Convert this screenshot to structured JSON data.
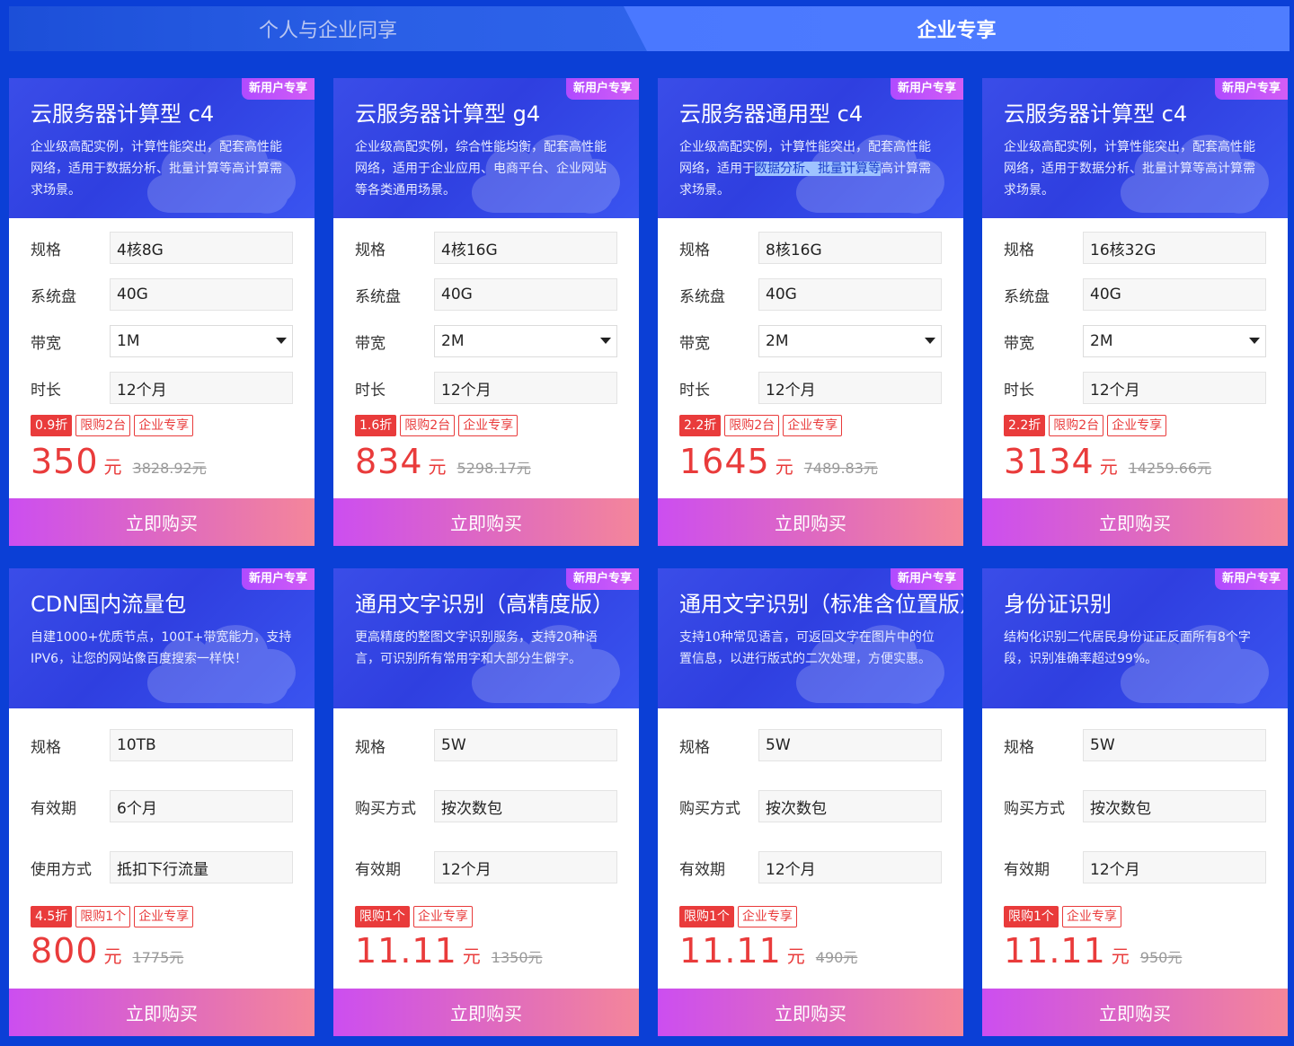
{
  "tabs": [
    {
      "label": "个人与企业同享",
      "active": false
    },
    {
      "label": "企业专享",
      "active": true
    }
  ],
  "colors": {
    "background": "#0b3fd6",
    "price": "#e93b3b",
    "badge": "#c557f8"
  },
  "row1": [
    {
      "badge": "新用户专享",
      "title": "云服务器计算型 c4",
      "desc": "企业级高配实例，计算性能突出，配套高性能网络，适用于数据分析、批量计算等高计算需求场景。",
      "fields": [
        {
          "label": "规格",
          "value": "4核8G",
          "select": false
        },
        {
          "label": "系统盘",
          "value": "40G",
          "select": false
        },
        {
          "label": "带宽",
          "value": "1M",
          "select": true
        },
        {
          "label": "时长",
          "value": "12个月",
          "select": false
        }
      ],
      "tags": [
        "0.9折",
        "限购2台",
        "企业专享"
      ],
      "price": "350",
      "unit": "元",
      "original": "3828.92元",
      "buy": "立即购买"
    },
    {
      "badge": "新用户专享",
      "title": "云服务器计算型 g4",
      "desc": "企业级高配实例，综合性能均衡，配套高性能网络，适用于企业应用、电商平台、企业网站等各类通用场景。",
      "fields": [
        {
          "label": "规格",
          "value": "4核16G",
          "select": false
        },
        {
          "label": "系统盘",
          "value": "40G",
          "select": false
        },
        {
          "label": "带宽",
          "value": "2M",
          "select": true
        },
        {
          "label": "时长",
          "value": "12个月",
          "select": false
        }
      ],
      "tags": [
        "1.6折",
        "限购2台",
        "企业专享"
      ],
      "price": "834",
      "unit": "元",
      "original": "5298.17元",
      "buy": "立即购买"
    },
    {
      "badge": "新用户专享",
      "title": "云服务器通用型 c4",
      "desc_pre": "企业级高配实例，计算性能突出，配套高性能网络，适用于",
      "desc_hl": "数据分析、批量计算等",
      "desc_post": "高计算需求场景。",
      "fields": [
        {
          "label": "规格",
          "value": "8核16G",
          "select": false
        },
        {
          "label": "系统盘",
          "value": "40G",
          "select": false
        },
        {
          "label": "带宽",
          "value": "2M",
          "select": true
        },
        {
          "label": "时长",
          "value": "12个月",
          "select": false
        }
      ],
      "tags": [
        "2.2折",
        "限购2台",
        "企业专享"
      ],
      "price": "1645",
      "unit": "元",
      "original": "7489.83元",
      "buy": "立即购买"
    },
    {
      "badge": "新用户专享",
      "title": "云服务器计算型 c4",
      "desc": "企业级高配实例，计算性能突出，配套高性能网络，适用于数据分析、批量计算等高计算需求场景。",
      "fields": [
        {
          "label": "规格",
          "value": "16核32G",
          "select": false
        },
        {
          "label": "系统盘",
          "value": "40G",
          "select": false
        },
        {
          "label": "带宽",
          "value": "2M",
          "select": true
        },
        {
          "label": "时长",
          "value": "12个月",
          "select": false
        }
      ],
      "tags": [
        "2.2折",
        "限购2台",
        "企业专享"
      ],
      "price": "3134",
      "unit": "元",
      "original": "14259.66元",
      "buy": "立即购买"
    }
  ],
  "row2": [
    {
      "badge": "新用户专享",
      "title": "CDN国内流量包",
      "desc": "自建1000+优质节点，100T+带宽能力，支持IPV6，让您的网站像百度搜索一样快！",
      "fields": [
        {
          "label": "规格",
          "value": "10TB"
        },
        {
          "label": "有效期",
          "value": "6个月"
        },
        {
          "label": "使用方式",
          "value": "抵扣下行流量"
        }
      ],
      "tags": [
        "4.5折",
        "限购1个",
        "企业专享"
      ],
      "price": "800",
      "unit": "元",
      "original": "1775元",
      "buy": "立即购买"
    },
    {
      "badge": "新用户专享",
      "title": "通用文字识别（高精度版）",
      "desc": "更高精度的整图文字识别服务，支持20种语言，可识别所有常用字和大部分生僻字。",
      "fields": [
        {
          "label": "规格",
          "value": "5W"
        },
        {
          "label": "购买方式",
          "value": "按次数包"
        },
        {
          "label": "有效期",
          "value": "12个月"
        }
      ],
      "tags": [
        "限购1个",
        "企业专享"
      ],
      "price": "11.11",
      "unit": "元",
      "original": "1350元",
      "buy": "立即购买"
    },
    {
      "badge": "新用户专享",
      "title": "通用文字识别（标准含位置版）",
      "desc": "支持10种常见语言，可返回文字在图片中的位置信息，以进行版式的二次处理，方便实惠。",
      "fields": [
        {
          "label": "规格",
          "value": "5W"
        },
        {
          "label": "购买方式",
          "value": "按次数包"
        },
        {
          "label": "有效期",
          "value": "12个月"
        }
      ],
      "tags": [
        "限购1个",
        "企业专享"
      ],
      "price": "11.11",
      "unit": "元",
      "original": "490元",
      "buy": "立即购买"
    },
    {
      "badge": "新用户专享",
      "title": "身份证识别",
      "desc": "结构化识别二代居民身份证正反面所有8个字段，识别准确率超过99%。",
      "fields": [
        {
          "label": "规格",
          "value": "5W"
        },
        {
          "label": "购买方式",
          "value": "按次数包"
        },
        {
          "label": "有效期",
          "value": "12个月"
        }
      ],
      "tags": [
        "限购1个",
        "企业专享"
      ],
      "price": "11.11",
      "unit": "元",
      "original": "950元",
      "buy": "立即购买"
    }
  ]
}
